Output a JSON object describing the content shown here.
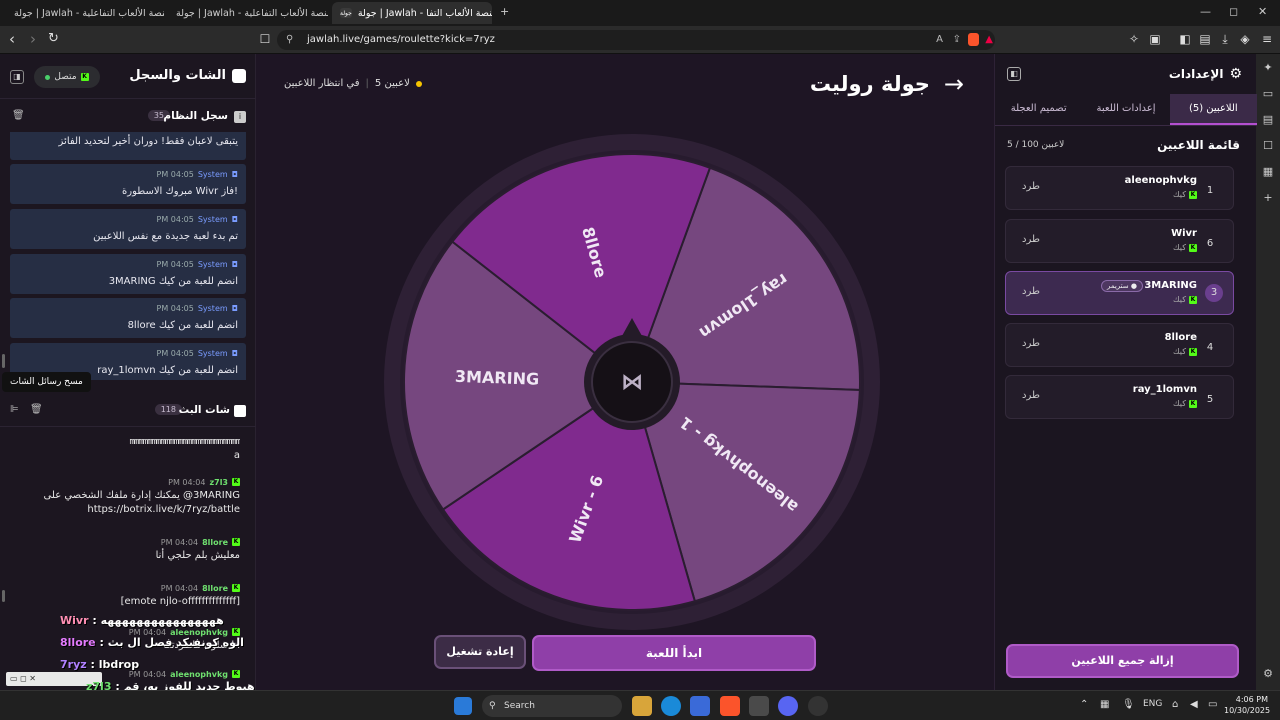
{
  "browser": {
    "tabs": [
      {
        "label": "جولة | Jawlah - منصة الألعاب التفاعلية",
        "icon": "jawlah",
        "active": false
      },
      {
        "label": "جولة | Jawlah - منصة الألعاب التفاعلية",
        "icon": "jawlah",
        "active": false
      },
      {
        "label": "جولة | Jawlah - منصة الألعاب التفا",
        "icon": "jawlah",
        "active": true
      }
    ],
    "fav_label": "جولة",
    "url": "jawlah.live/games/roulette?kick=7ryz"
  },
  "chat": {
    "title": "الشات والسجل",
    "status": "متصل",
    "system_log": {
      "title": "سجل النظام",
      "count": "35"
    },
    "system_messages": [
      {
        "text": "يتبقى لاعبان فقط! دوران أخير لتحديد الفائز",
        "sender": "",
        "time": ""
      },
      {
        "text": "مبروك الاسطورة Wivr فاز!",
        "sender": "System",
        "time": "PM 04:05"
      },
      {
        "text": "تم بدء لعبة جديدة مع نفس اللاعبين",
        "sender": "System",
        "time": "PM 04:05"
      },
      {
        "text": "3MARING انضم للعبة من كيك",
        "sender": "System",
        "time": "PM 04:05"
      },
      {
        "text": "8llore انضم للعبة من كيك",
        "sender": "System",
        "time": "PM 04:05"
      },
      {
        "text": "ray_1lomvn انضم للعبة من كيك",
        "sender": "System",
        "time": "PM 04:05"
      }
    ],
    "tooltip": "مسح رسائل الشات",
    "stream_chat": {
      "title": "شات البث",
      "count": "118"
    },
    "stream_messages": [
      {
        "sender": "",
        "time": "",
        "lines": [
          "mmmmmmmmmmmmmmmmmmmmmmmmm",
          "a"
        ]
      },
      {
        "sender": "z7l3",
        "time": "PM 04:04",
        "lines": [
          "3MARING@ يمكنك إدارة ملفك الشخصي على",
          "https://botrix.live/k/7ryz/battle"
        ]
      },
      {
        "sender": "8llore",
        "time": "PM 04:04",
        "lines": [
          "معليش بلم حلجي أنا"
        ]
      },
      {
        "sender": "8llore",
        "time": "PM 04:04",
        "lines": [
          "[emote njlo-offffffffffffff]"
        ]
      }
    ],
    "overlay_lines": [
      {
        "name": "Wivr",
        "text": ": ههههههههههههههههه"
      },
      {
        "name": "8llore",
        "text": ": الوه كونفيكد فصل ال بث"
      },
      {
        "name": "7ryz",
        "text": ": lbdrop"
      },
      {
        "name": "z7l3",
        "text": ": تنبيه: ظهر هيوط جديد للفوز به، قم"
      },
      {
        "name": "",
        "text": "? = بحل هذا السؤال الرياضي بأسرع وقت في الدردشة: 5 - 8"
      }
    ],
    "bottom_messages": [
      {
        "sender": "aleenophvkg",
        "time": "PM 04:04",
        "text": "أنا شلون ماطردتك"
      },
      {
        "sender": "aleenophvkg",
        "time": "PM 04:04",
        "text": ""
      }
    ]
  },
  "main": {
    "title": "جولة روليت",
    "status_players": "5 لاعبين",
    "status_waiting": "في انتظار اللاعبين",
    "segments": [
      {
        "label": "ray_1lomvn",
        "color": "#76477f"
      },
      {
        "label": "aleenophvkg - 1",
        "color": "#76477f"
      },
      {
        "label": "Wivr - 6",
        "color": "#802a8e"
      },
      {
        "label": "3MARING",
        "color": "#76477f"
      },
      {
        "label": "8llore",
        "color": "#802a8e"
      }
    ],
    "start_button": "ابدأ اللعبة",
    "restart_button": "إعادة تشغيل"
  },
  "settings": {
    "title": "الإعدادات",
    "tabs": [
      {
        "label": "اللاعبين (5)",
        "active": true
      },
      {
        "label": "إعدادات اللعبة",
        "active": false
      },
      {
        "label": "تصميم العجلة",
        "active": false
      }
    ],
    "list_title": "قائمة اللاعبين",
    "list_count": "5 / 100 لاعبين",
    "kick_label": "طرد",
    "platform": "كيك",
    "streamer_badge": "ستريمر",
    "players": [
      {
        "num": "1",
        "name": "aleenophvkg",
        "highlight": false,
        "streamer": false
      },
      {
        "num": "6",
        "name": "Wivr",
        "highlight": false,
        "streamer": false
      },
      {
        "num": "3",
        "name": "3MARING",
        "highlight": true,
        "streamer": true
      },
      {
        "num": "4",
        "name": "8llore",
        "highlight": false,
        "streamer": false
      },
      {
        "num": "5",
        "name": "ray_1lomvn",
        "highlight": false,
        "streamer": false
      }
    ],
    "remove_all": "إزالة جميع اللاعبين"
  },
  "taskbar": {
    "search": "Search",
    "lang": "ENG",
    "time": "4:06 PM",
    "date": "10/30/2025"
  }
}
